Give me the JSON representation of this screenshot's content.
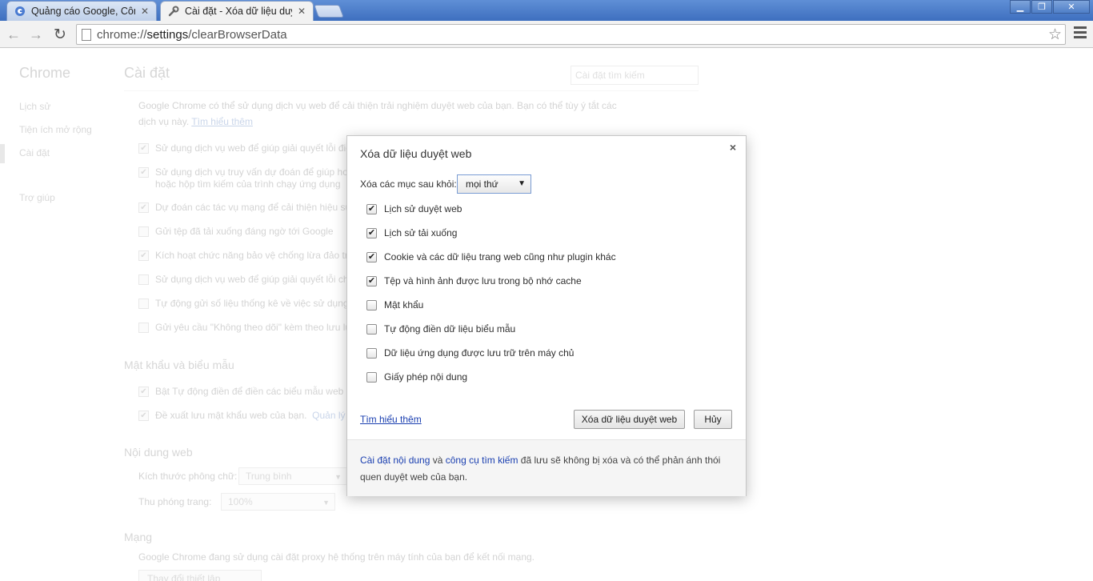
{
  "tabs": [
    {
      "title": "Quảng cáo Google, Công",
      "favicon": "google-icon",
      "active": false
    },
    {
      "title": "Cài đặt - Xóa dữ liệu duyệt",
      "favicon": "wrench-icon",
      "active": true
    }
  ],
  "toolbar": {
    "url_scheme": "chrome://",
    "url_host": "settings",
    "url_path": "/clearBrowserData"
  },
  "sidebar": {
    "brand": "Chrome",
    "items": [
      "Lịch sử",
      "Tiện ích mở rộng",
      "Cài đặt",
      "Trợ giúp"
    ]
  },
  "settings": {
    "title": "Cài đặt",
    "search_placeholder": "Cài đặt tìm kiếm",
    "privacy_intro_line1": "Google Chrome có thể sử dụng dịch vụ web để cải thiện trải nghiệm duyệt web của bạn. Bạn có thể tùy ý tắt các",
    "privacy_intro_line2": "dịch vụ này.",
    "privacy_learn_more": "Tìm hiểu thêm",
    "privacy_options": [
      {
        "label": "Sử dụng dịch vụ web để giúp giải quyết lỗi điề",
        "checked": true
      },
      {
        "label": "Sử dụng dịch vụ truy vấn dự đoán để giúp hoà",
        "label2": "hoặc hộp tìm kiếm của trình chạy ứng dụng",
        "checked": true
      },
      {
        "label": "Dự đoán các tác vụ mạng để cải thiện hiệu suấ",
        "checked": true
      },
      {
        "label": "Gửi tệp đã tải xuống đáng ngờ tới Google",
        "checked": false
      },
      {
        "label": "Kích hoạt chức năng bảo vệ chống lừa đảo trự",
        "checked": true
      },
      {
        "label": "Sử dụng dịch vụ web để giúp giải quyết lỗi chín",
        "checked": false
      },
      {
        "label": "Tự động gửi số liệu thống kê về việc sử dụng",
        "checked": false
      },
      {
        "label": "Gửi yêu cầu \"Không theo dõi\" kèm theo lưu lượ",
        "checked": false
      }
    ],
    "passwords_heading": "Mật khẩu và biểu mẫu",
    "passwords_options": [
      {
        "label": "Bật Tự động điền để điền các biểu mẫu web c",
        "checked": true
      },
      {
        "label": "Đề xuất lưu mật khẩu web của bạn.",
        "link": "Quản lý m",
        "checked": true
      }
    ],
    "webcontent_heading": "Nội dung web",
    "font_size_label": "Kích thước phông chữ:",
    "font_size_value": "Trung bình",
    "zoom_label": "Thu phóng trang:",
    "zoom_value": "100%",
    "network_heading": "Mạng",
    "network_text": "Google Chrome đang sử dụng cài đặt proxy hệ thống trên máy tính của bạn để kết nối mạng.",
    "proxy_button": "Thay đổi thiết lập proxy..."
  },
  "dialog": {
    "title": "Xóa dữ liệu duyệt web",
    "clear_label": "Xóa các mục sau khỏi:",
    "time_range": "mọi thứ",
    "options": [
      {
        "label": "Lịch sử duyệt web",
        "checked": true
      },
      {
        "label": "Lịch sử tải xuống",
        "checked": true
      },
      {
        "label": "Cookie và các dữ liệu trang web cũng như plugin khác",
        "checked": true
      },
      {
        "label": "Tệp và hình ảnh được lưu trong bộ nhớ cache",
        "checked": true
      },
      {
        "label": "Mật khẩu",
        "checked": false
      },
      {
        "label": "Tự động điền dữ liệu biểu mẫu",
        "checked": false
      },
      {
        "label": "Dữ liệu ứng dụng được lưu trữ trên máy chủ",
        "checked": false
      },
      {
        "label": "Giấy phép nội dung",
        "checked": false
      }
    ],
    "learn_more": "Tìm hiểu thêm",
    "clear_button": "Xóa dữ liệu duyệt web",
    "cancel_button": "Hủy",
    "footer_link1": "Cài đặt nội dung",
    "footer_and": " và ",
    "footer_link2": "công cụ tìm kiếm",
    "footer_text": " đã lưu sẽ không bị xóa và có thể phản ánh thói quen duyệt web của bạn."
  }
}
